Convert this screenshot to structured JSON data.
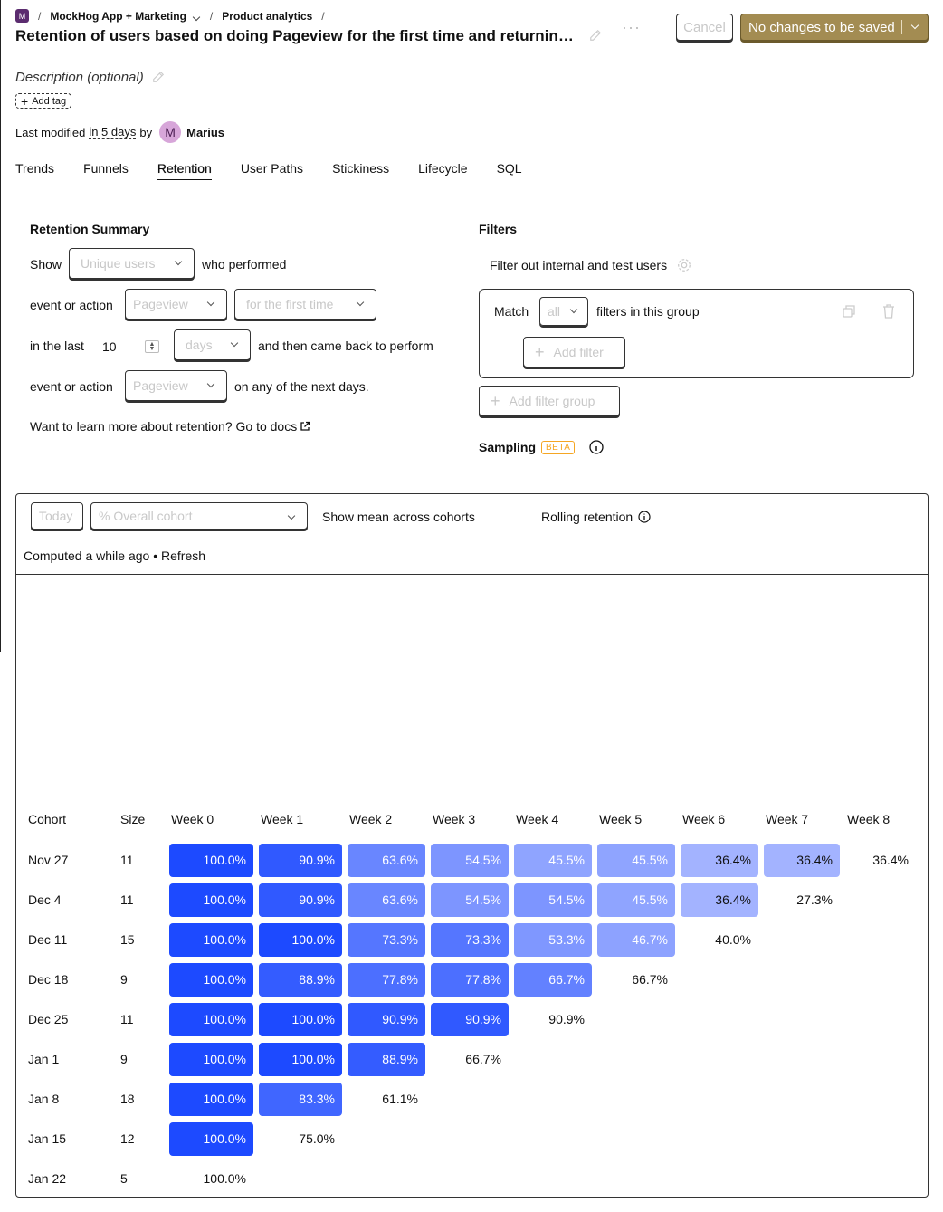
{
  "header": {
    "project_badge": "M",
    "project": "MockHog App + Marketing",
    "section": "Product analytics",
    "title": "Retention of users based on doing Pageview for the first time and returning with the same event",
    "description_placeholder": "Description (optional)",
    "add_tag": "Add tag",
    "modified_prefix": "Last modified",
    "modified_time": "in 5 days",
    "modified_by": "by",
    "avatar_letter": "M",
    "user": "Marius",
    "more": "···",
    "cancel": "Cancel",
    "save": "No changes to be saved"
  },
  "tabs": [
    {
      "label": "Trends"
    },
    {
      "label": "Funnels"
    },
    {
      "label": "Retention",
      "active": true
    },
    {
      "label": "User Paths"
    },
    {
      "label": "Stickiness"
    },
    {
      "label": "Lifecycle"
    },
    {
      "label": "SQL"
    }
  ],
  "summary": {
    "title": "Retention Summary",
    "show": "Show",
    "show_select": "Unique users",
    "who_performed": "who performed",
    "event_or_action_1": "event or action",
    "target_event": "Pageview",
    "first_time": "for the first time",
    "in_the_last": "in the last",
    "period_count": "10",
    "period_unit": "days",
    "came_back": "and then came back to perform",
    "event_or_action_2": "event or action",
    "returning_event": "Pageview",
    "any_next_days": "on any of the next days.",
    "docs": "Want to learn more about retention? Go to docs"
  },
  "filters": {
    "title": "Filters",
    "internal": "Filter out internal and test users",
    "match": "Match",
    "match_value": "all",
    "in_group": "filters in this group",
    "add_filter": "Add filter",
    "add_group": "Add filter group",
    "sampling": "Sampling",
    "beta": "BETA"
  },
  "results": {
    "date_select": "Today",
    "mode_select": "% Overall cohort",
    "mean": "Show mean across cohorts",
    "rolling": "Rolling retention",
    "computed": "Computed a while ago",
    "bullet": "•",
    "refresh": "Refresh"
  },
  "colors": {
    "accent": "#1d4aff",
    "save_button": "#a38c52",
    "beta": "#f5a623"
  },
  "table": {
    "headers": [
      "Cohort",
      "Size",
      "Week 0",
      "Week 1",
      "Week 2",
      "Week 3",
      "Week 4",
      "Week 5",
      "Week 6",
      "Week 7",
      "Week 8"
    ],
    "rows": [
      {
        "cohort": "Nov 27",
        "size": "11",
        "values": [
          "100.0%",
          "90.9%",
          "63.6%",
          "54.5%",
          "45.5%",
          "45.5%",
          "36.4%",
          "36.4%",
          "36.4%"
        ]
      },
      {
        "cohort": "Dec 4",
        "size": "11",
        "values": [
          "100.0%",
          "90.9%",
          "63.6%",
          "54.5%",
          "54.5%",
          "45.5%",
          "36.4%",
          "27.3%"
        ]
      },
      {
        "cohort": "Dec 11",
        "size": "15",
        "values": [
          "100.0%",
          "100.0%",
          "73.3%",
          "73.3%",
          "53.3%",
          "46.7%",
          "40.0%"
        ]
      },
      {
        "cohort": "Dec 18",
        "size": "9",
        "values": [
          "100.0%",
          "88.9%",
          "77.8%",
          "77.8%",
          "66.7%",
          "66.7%"
        ]
      },
      {
        "cohort": "Dec 25",
        "size": "11",
        "values": [
          "100.0%",
          "100.0%",
          "90.9%",
          "90.9%",
          "90.9%"
        ]
      },
      {
        "cohort": "Jan 1",
        "size": "9",
        "values": [
          "100.0%",
          "100.0%",
          "88.9%",
          "66.7%"
        ]
      },
      {
        "cohort": "Jan 8",
        "size": "18",
        "values": [
          "100.0%",
          "83.3%",
          "61.1%"
        ]
      },
      {
        "cohort": "Jan 15",
        "size": "12",
        "values": [
          "100.0%",
          "75.0%"
        ]
      },
      {
        "cohort": "Jan 22",
        "size": "5",
        "values": [
          "100.0%"
        ]
      }
    ]
  }
}
